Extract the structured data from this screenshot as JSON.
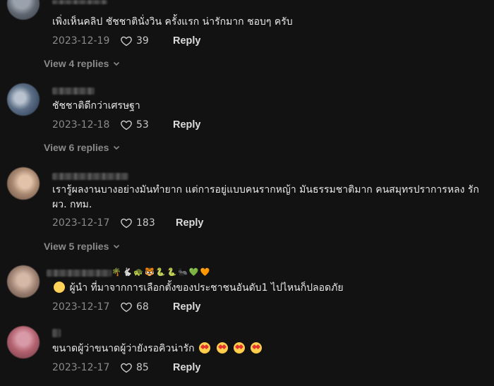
{
  "comments": [
    {
      "text": "เพิ่งเห็นคลิป ชัชชาตินั่งวิน ครั้งแรก น่ารักมาก ชอบๆ ครับ",
      "date": "2023-12-19",
      "likes": "39",
      "reply_label": "Reply",
      "view_replies": "View 4 replies"
    },
    {
      "text": "ชัชชาติดีกว่าเศรษฐา",
      "date": "2023-12-18",
      "likes": "53",
      "reply_label": "Reply",
      "view_replies": "View 6 replies"
    },
    {
      "text": "เรารู้ผลงานบางอย่างมันทำยาก แต่การอยู่แบบคนรากหญ้า มันธรรมชาติมาก คนสมุทรปราการหลง รัก ผว. กทม.",
      "date": "2023-12-17",
      "likes": "183",
      "reply_label": "Reply",
      "view_replies": "View 5 replies"
    },
    {
      "text": "ผู้นำ ที่มาจากการเลือกตั้งของประชาชนอันดับ1 ไปไหนก็ปลอดภัย",
      "date": "2023-12-17",
      "likes": "68",
      "reply_label": "Reply",
      "name_emojis": "🌴🐇🐢🐯🐍🐍🐜💚🧡"
    },
    {
      "text": "ขนาดผู้ว่าขนาดผู้ว่ายังรอคิวน่ารัก",
      "date": "2023-12-17",
      "likes": "85",
      "reply_label": "Reply"
    }
  ],
  "icons": {
    "like": "heart-outline-icon",
    "expand": "chevron-down-icon"
  },
  "colors": {
    "background": "#121212",
    "muted": "#8a8a8a",
    "text": "#e6e6e6"
  }
}
